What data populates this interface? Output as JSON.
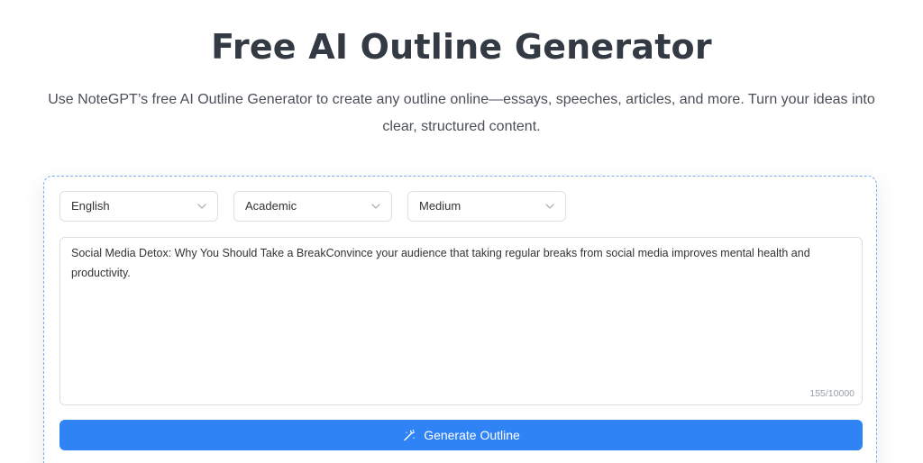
{
  "header": {
    "title": "Free AI Outline Generator",
    "subtitle": "Use NoteGPT’s free AI Outline Generator to create any outline online—essays, speeches, articles, and more. Turn your ideas into clear, structured content."
  },
  "options": {
    "language": "English",
    "style": "Academic",
    "length": "Medium"
  },
  "input": {
    "value": "Social Media Detox: Why You Should Take a BreakConvince your audience that taking regular breaks from social media improves mental health and productivity.",
    "counter": "155/10000"
  },
  "action": {
    "generate_label": "Generate Outline",
    "icon": "magic-wand-icon"
  },
  "colors": {
    "primary": "#2f83f5",
    "card_border": "#7aaaf0",
    "title": "#333a44"
  }
}
